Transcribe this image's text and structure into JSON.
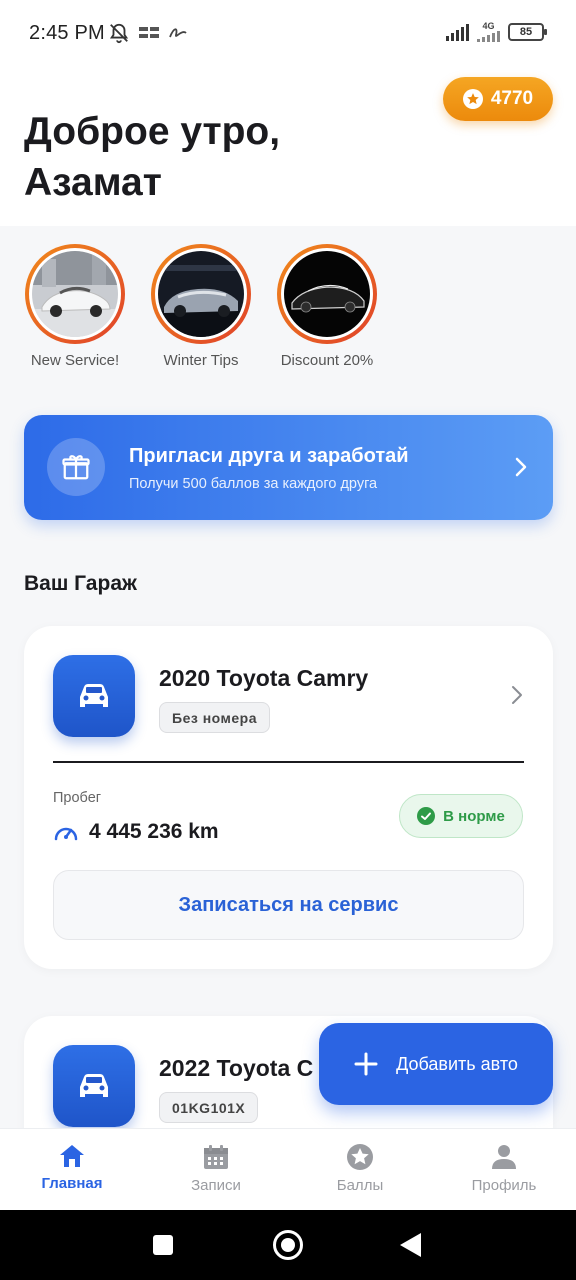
{
  "status_bar": {
    "time": "2:45 PM",
    "net_label": "4G",
    "battery": "85"
  },
  "header": {
    "greeting_line1": "Доброе утро,",
    "greeting_line2": "Азамат",
    "points": "4770"
  },
  "stories": [
    {
      "label": "New Service!"
    },
    {
      "label": "Winter Tips"
    },
    {
      "label": "Discount 20%"
    }
  ],
  "invite": {
    "title": "Пригласи друга и заработай",
    "subtitle": "Получи 500 баллов за каждого друга"
  },
  "garage": {
    "title": "Ваш Гараж",
    "cars": [
      {
        "name": "2020 Toyota Camry",
        "plate": "Без номера",
        "mileage_label": "Пробег",
        "mileage": "4 445 236 km",
        "status": "В норме",
        "service_button": "Записаться на сервис"
      },
      {
        "name": "2022 Toyota C",
        "plate": "01KG101X"
      }
    ]
  },
  "fab": {
    "label": "Добавить авто"
  },
  "bottom_nav": [
    {
      "label": "Главная",
      "icon": "home-icon",
      "active": true
    },
    {
      "label": "Записи",
      "icon": "calendar-icon",
      "active": false
    },
    {
      "label": "Баллы",
      "icon": "star-icon",
      "active": false
    },
    {
      "label": "Профиль",
      "icon": "person-icon",
      "active": false
    }
  ],
  "colors": {
    "accent": "#2b64e3",
    "points_orange": "#ec8a0c",
    "ok_green": "#2e9b48"
  }
}
